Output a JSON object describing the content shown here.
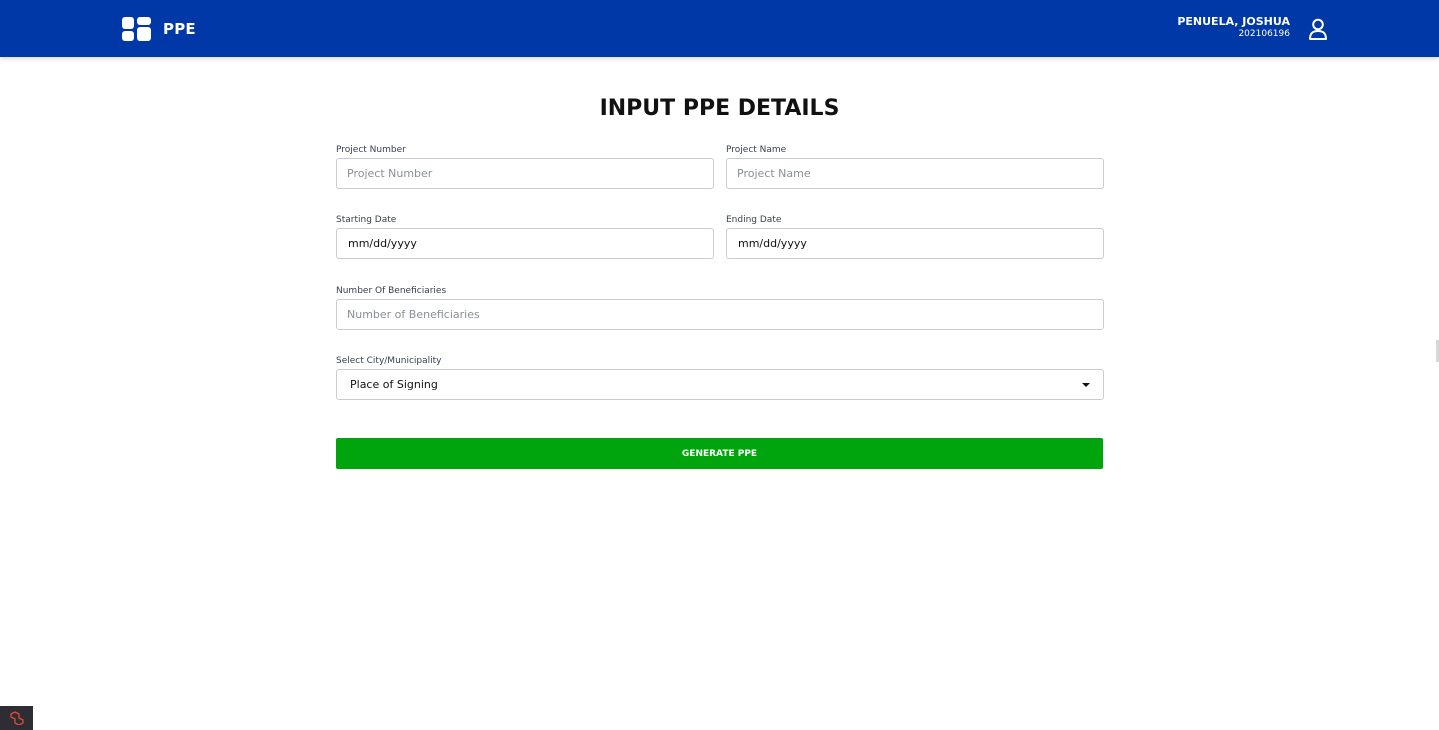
{
  "header": {
    "app_title": "PPE",
    "logo_icon": "dashboard-grid-icon",
    "user_name": "PENUELA, JOSHUA",
    "user_id": "202106196",
    "user_icon": "user-icon"
  },
  "form": {
    "title": "INPUT PPE DETAILS",
    "project_number": {
      "label": "Project Number",
      "placeholder": "Project Number",
      "value": ""
    },
    "project_name": {
      "label": "Project Name",
      "placeholder": "Project Name",
      "value": ""
    },
    "starting_date": {
      "label": "Starting Date",
      "value": "mm/dd/yyyy"
    },
    "ending_date": {
      "label": "Ending Date",
      "value": "mm/dd/yyyy"
    },
    "beneficiaries": {
      "label": "Number Of Beneficiaries",
      "placeholder": "Number of Beneficiaries",
      "value": ""
    },
    "city": {
      "label": "Select City/Municipality",
      "selected": "Place of Signing"
    },
    "submit_label": "GENERATE PPE"
  },
  "colors": {
    "header_bg": "#0038a8",
    "button_bg": "#00a50d"
  }
}
